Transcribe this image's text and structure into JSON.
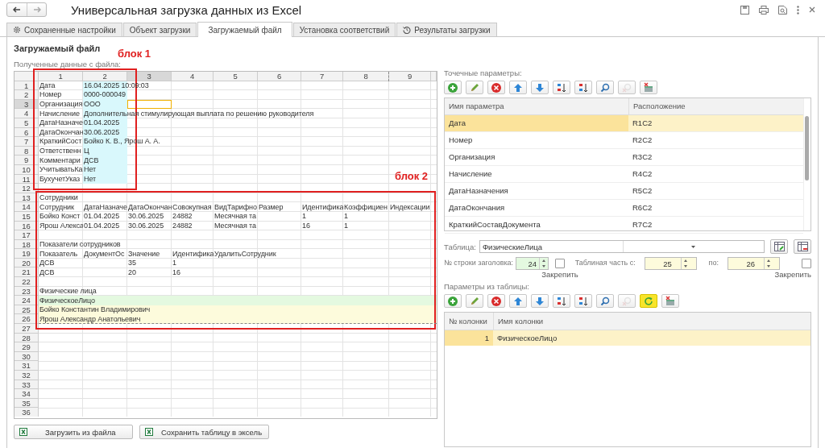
{
  "window": {
    "title": "Универсальная загрузка данных из Excel"
  },
  "tabs": [
    {
      "label": "Сохраненные настройки",
      "kind": "settings",
      "selected": false
    },
    {
      "label": "Объект загрузки",
      "kind": "plain",
      "selected": false
    },
    {
      "label": "Загружаемый файл",
      "kind": "plain",
      "selected": true
    },
    {
      "label": "Установка соответствий",
      "kind": "plain",
      "selected": false
    },
    {
      "label": "Результаты загрузки",
      "kind": "history",
      "selected": false
    }
  ],
  "section_title": "Загружаемый файл",
  "sheet": {
    "label": "Полученные данные с файла:",
    "columns": [
      {
        "label": "1",
        "selected": false
      },
      {
        "label": "2",
        "selected": false
      },
      {
        "label": "3",
        "selected": true
      },
      {
        "label": "4",
        "selected": false
      },
      {
        "label": "5",
        "selected": false
      },
      {
        "label": "6",
        "selected": false
      },
      {
        "label": "7",
        "selected": false
      },
      {
        "label": "8",
        "selected": false
      },
      {
        "label": "9",
        "selected": false
      }
    ],
    "rows": [
      {
        "number": "1",
        "selected": false,
        "value_highlight": true,
        "cells": [
          "Дата",
          "16.04.2025 10:09:03"
        ]
      },
      {
        "number": "2",
        "selected": false,
        "value_highlight": true,
        "cells": [
          "Номер",
          "0000-000049"
        ]
      },
      {
        "number": "3",
        "selected": true,
        "value_highlight": true,
        "cells": [
          "Организация",
          "ООО"
        ]
      },
      {
        "number": "4",
        "selected": false,
        "value_highlight": true,
        "cells": [
          "Начисление",
          "Дополнительная стимулирующая выплата по решению руководителя"
        ]
      },
      {
        "number": "5",
        "selected": false,
        "value_highlight": true,
        "cells": [
          "ДатаНазначе",
          "01.04.2025"
        ]
      },
      {
        "number": "6",
        "selected": false,
        "value_highlight": true,
        "cells": [
          "ДатаОкончан",
          "30.06.2025"
        ]
      },
      {
        "number": "7",
        "selected": false,
        "value_highlight": true,
        "cells": [
          "КраткийСост",
          "Бойко К. В., Ярош А. А."
        ]
      },
      {
        "number": "8",
        "selected": false,
        "value_highlight": true,
        "cells": [
          "Ответственн",
          "Ц"
        ]
      },
      {
        "number": "9",
        "selected": false,
        "value_highlight": true,
        "cells": [
          "Комментари",
          "ДСВ"
        ]
      },
      {
        "number": "10",
        "selected": false,
        "value_highlight": true,
        "cells": [
          "УчитыватьКа",
          "Нет"
        ]
      },
      {
        "number": "11",
        "selected": false,
        "value_highlight": true,
        "cells": [
          "БухучетУказ",
          "Нет"
        ]
      },
      {
        "number": "12",
        "selected": false
      },
      {
        "number": "13",
        "selected": false,
        "cells": [
          "Сотрудники"
        ]
      },
      {
        "number": "14",
        "selected": false,
        "cells": [
          "Сотрудник",
          "ДатаНазначе",
          "ДатаОкончан",
          "Совокупная",
          "ВидТарифно",
          "Размер",
          "Идентифика",
          "Коэффициен",
          "Индексации"
        ]
      },
      {
        "number": "15",
        "selected": false,
        "cells": [
          "Бойко Конст",
          "01.04.2025",
          "30.06.2025",
          "24882",
          "Месячная та",
          null,
          "1",
          "1"
        ]
      },
      {
        "number": "16",
        "selected": false,
        "cells": [
          "Ярош Алекса",
          "01.04.2025",
          "30.06.2025",
          "24882",
          "Месячная та",
          null,
          "16",
          "1"
        ]
      },
      {
        "number": "17",
        "selected": false
      },
      {
        "number": "18",
        "selected": false,
        "cells": [
          "Показатели сотрудников"
        ]
      },
      {
        "number": "19",
        "selected": false,
        "cells": [
          "Показатель",
          "ДокументОс",
          "Значение",
          "Идентифика",
          "УдалитьСотрудник"
        ]
      },
      {
        "number": "20",
        "selected": false,
        "cells": [
          "ДСВ",
          null,
          "35",
          "1"
        ]
      },
      {
        "number": "21",
        "selected": false,
        "cells": [
          "ДСВ",
          null,
          "20",
          "16"
        ]
      },
      {
        "number": "22",
        "selected": false
      },
      {
        "number": "23",
        "selected": false,
        "cells": [
          "Физические лица"
        ]
      },
      {
        "number": "24",
        "selected": false,
        "kind": "table_header",
        "cells": [
          "ФизическоеЛицо"
        ]
      },
      {
        "number": "25",
        "selected": false,
        "kind": "table_row",
        "cells": [
          "Бойко Константин Владимирович"
        ]
      },
      {
        "number": "26",
        "selected": false,
        "kind": "table_row",
        "cells": [
          "Ярош Александр Анатольевич"
        ]
      },
      {
        "number": "27",
        "selected": false
      },
      {
        "number": "28",
        "selected": false
      },
      {
        "number": "29",
        "selected": false
      },
      {
        "number": "30",
        "selected": false
      },
      {
        "number": "31",
        "selected": false
      },
      {
        "number": "32",
        "selected": false
      },
      {
        "number": "33",
        "selected": false
      },
      {
        "number": "34",
        "selected": false
      },
      {
        "number": "35",
        "selected": false
      },
      {
        "number": "36",
        "selected": false
      }
    ],
    "annotations": [
      {
        "label": "блок 1"
      },
      {
        "label": "блок 2"
      }
    ]
  },
  "sheet_buttons": [
    "Загрузить из файла",
    "Сохранить таблицу в эксель"
  ],
  "point_params": {
    "label": "Точечные параметры:",
    "toolbar": [
      {
        "kind": "add",
        "disabled": false
      },
      {
        "kind": "edit",
        "disabled": false
      },
      {
        "kind": "delete",
        "disabled": false
      },
      {
        "kind": "up",
        "disabled": false
      },
      {
        "kind": "down",
        "disabled": false
      },
      {
        "kind": "sort_asc",
        "disabled": false
      },
      {
        "kind": "sort_desc",
        "disabled": false
      },
      {
        "kind": "find",
        "disabled": false
      },
      {
        "kind": "find_cancel",
        "disabled": true
      },
      {
        "kind": "clear",
        "disabled": false
      }
    ],
    "columns": [
      "Имя параметра",
      "Расположение"
    ],
    "rows": [
      {
        "name": "Дата",
        "location": "R1C2",
        "selected": true
      },
      {
        "name": "Номер",
        "location": "R2C2",
        "selected": false
      },
      {
        "name": "Организация",
        "location": "R3C2",
        "selected": false
      },
      {
        "name": "Начисление",
        "location": "R4C2",
        "selected": false
      },
      {
        "name": "ДатаНазначения",
        "location": "R5C2",
        "selected": false
      },
      {
        "name": "ДатаОкончания",
        "location": "R6C2",
        "selected": false
      },
      {
        "name": "КраткийСоставДокумента",
        "location": "R7C2",
        "selected": false
      }
    ]
  },
  "table_field": {
    "label": "Таблица:",
    "value": "ФизическиеЛица"
  },
  "header_row": {
    "label": "№ строки заголовка:",
    "value": "24",
    "kind": "header",
    "pin_label": "Закрепить",
    "checked": false
  },
  "body_range": {
    "label": "Таблиная часть с:",
    "from": "25",
    "to_label": "по:",
    "to": "26",
    "kind": "body",
    "pin_label": "Закрепить",
    "checked": false
  },
  "table_params": {
    "label": "Параметры из таблицы:",
    "toolbar": [
      {
        "kind": "add",
        "disabled": false
      },
      {
        "kind": "edit",
        "disabled": false
      },
      {
        "kind": "delete",
        "disabled": false
      },
      {
        "kind": "up",
        "disabled": false
      },
      {
        "kind": "down",
        "disabled": false
      },
      {
        "kind": "sort_asc",
        "disabled": false
      },
      {
        "kind": "sort_desc",
        "disabled": false
      },
      {
        "kind": "find",
        "disabled": false
      },
      {
        "kind": "find_cancel",
        "disabled": true
      },
      {
        "kind": "refresh",
        "disabled": false
      },
      {
        "kind": "clear",
        "disabled": false
      }
    ],
    "columns": [
      "№ колонки",
      "Имя колонки"
    ],
    "rows": [
      {
        "number": "1",
        "name": "ФизическоеЛицо",
        "selected": true
      }
    ]
  }
}
